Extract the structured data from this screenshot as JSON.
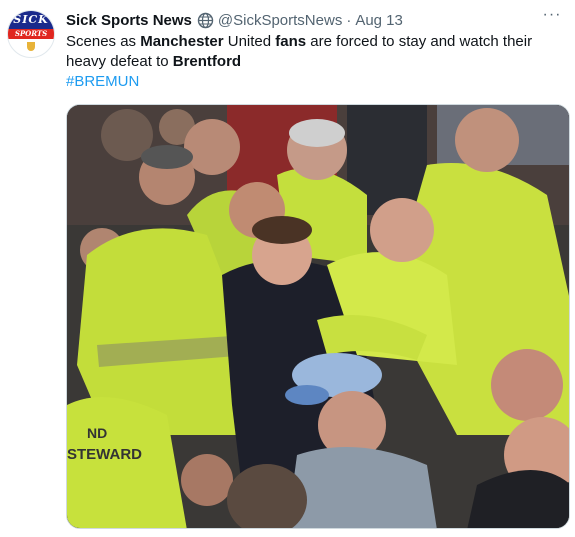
{
  "author": {
    "display_name": "Sick Sports News",
    "handle": "@SickSportsNews",
    "separator": "·",
    "date": "Aug 13",
    "avatar_logo_top": "SICK",
    "avatar_logo_bottom": "SPORTS"
  },
  "tweet": {
    "text_parts": [
      {
        "text": "Scenes as ",
        "bold": false
      },
      {
        "text": "Manchester",
        "bold": true
      },
      {
        "text": " United ",
        "bold": false
      },
      {
        "text": "fans",
        "bold": true
      },
      {
        "text": " are forced to stay and watch their heavy defeat to ",
        "bold": false
      },
      {
        "text": "Brentford",
        "bold": true
      }
    ],
    "hashtag": "#BREMUN"
  },
  "media": {
    "vest_text": "STEWARD",
    "vest_text_top": "ND"
  },
  "icons": {
    "more": "more-options-icon",
    "verified": "globe-icon"
  },
  "colors": {
    "link": "#1d9bf0",
    "secondary_text": "#536471",
    "vest": "#c7e23a"
  }
}
